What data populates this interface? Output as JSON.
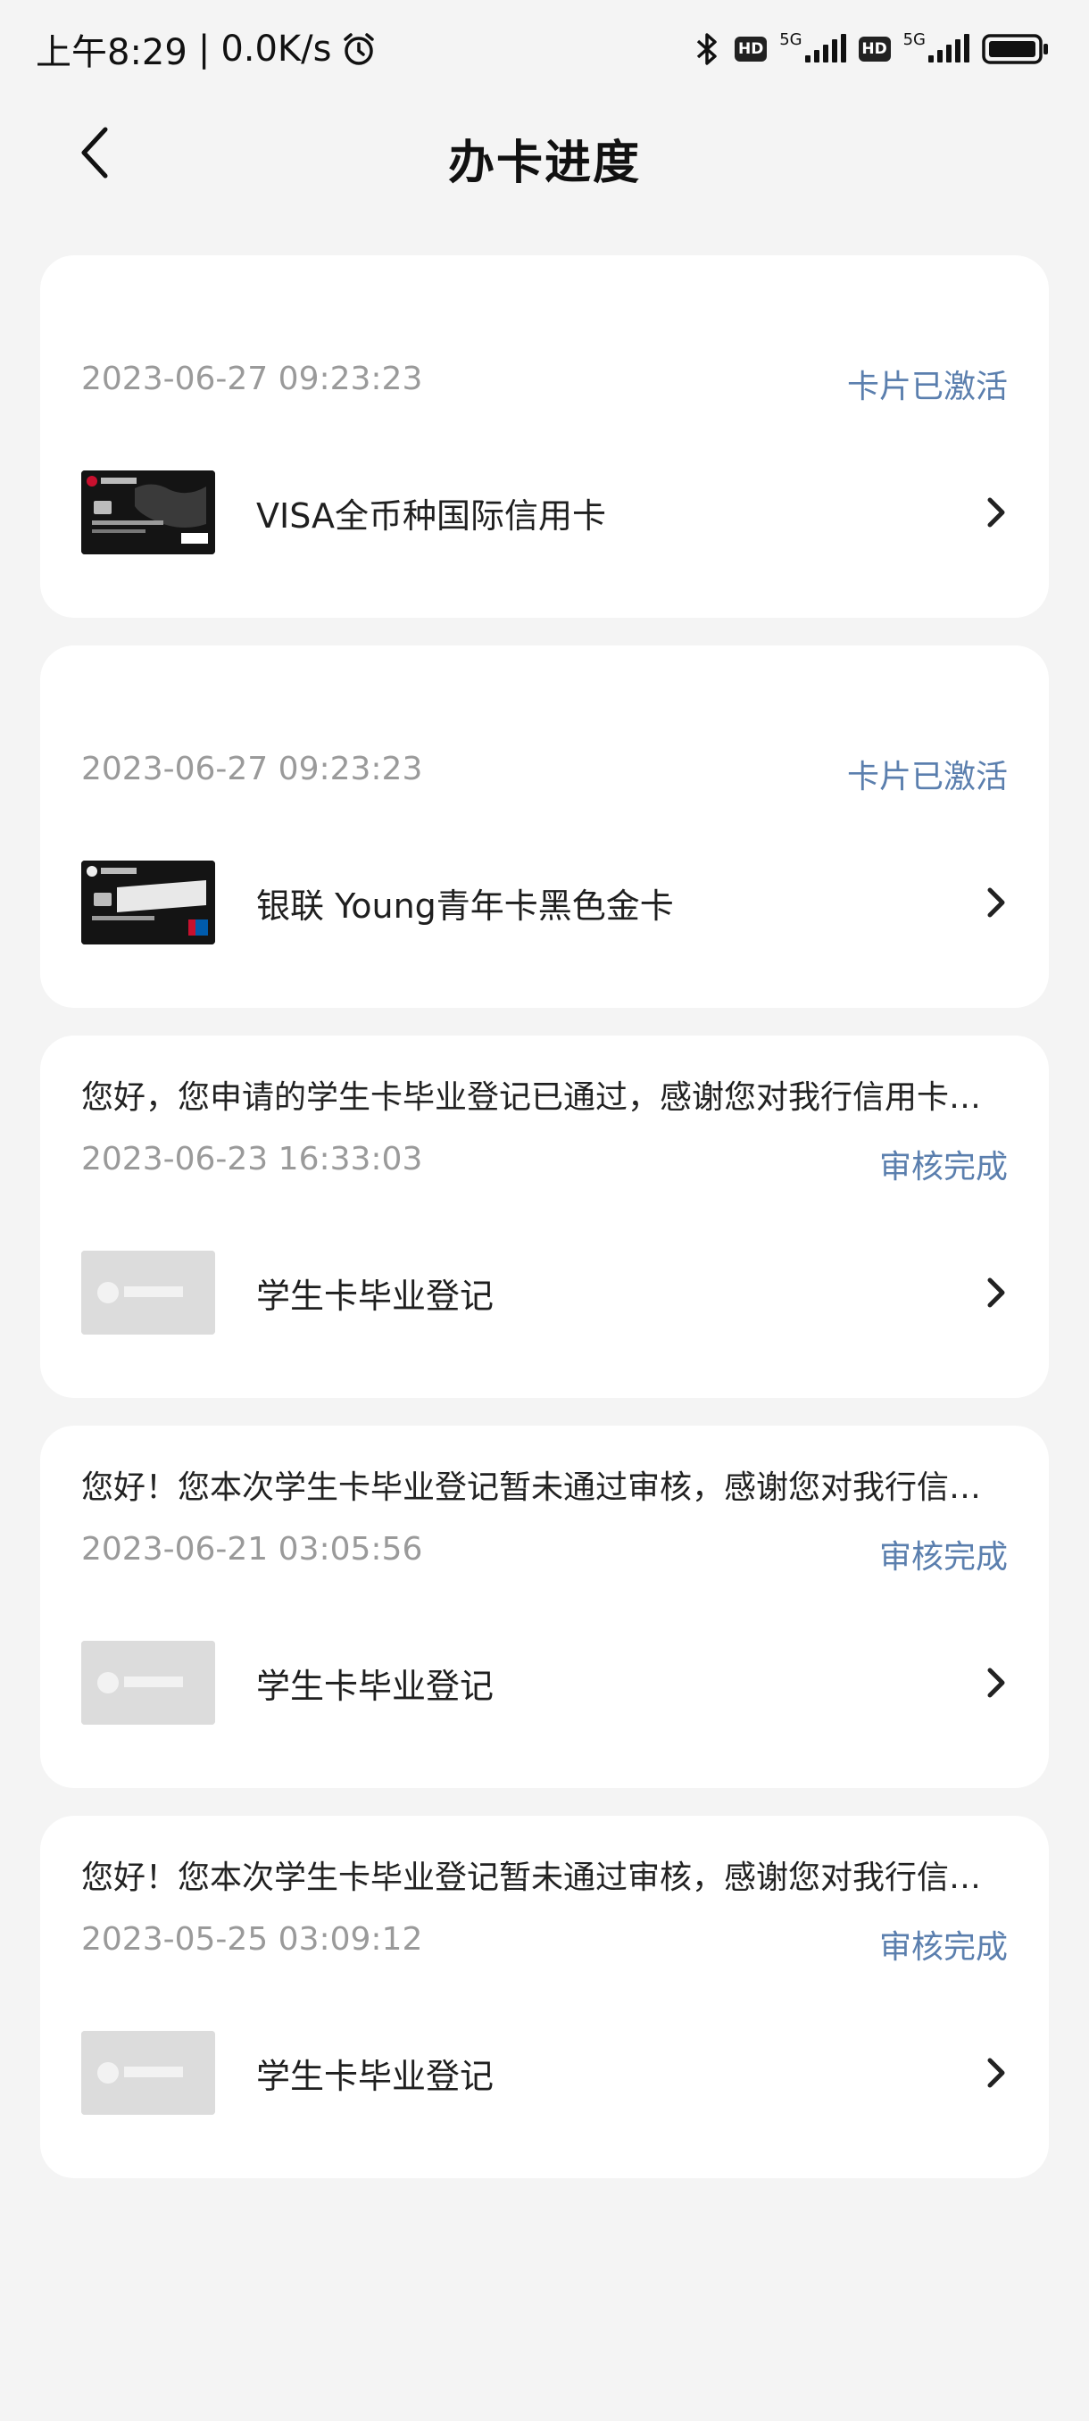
{
  "status_bar": {
    "time": "上午8:29",
    "separator": "|",
    "speed": "0.0K/s",
    "hd1": "HD",
    "net1": "5G",
    "hd2": "HD",
    "net2": "5G",
    "icons": [
      "alarm-icon",
      "bluetooth-icon",
      "signal-icon",
      "battery-icon"
    ]
  },
  "header": {
    "title": "办卡进度"
  },
  "cards": [
    {
      "message": "",
      "date": "2023-06-27 09:23:23",
      "status": "卡片已激活",
      "name": "VISA全币种国际信用卡",
      "thumb_style": "dark"
    },
    {
      "message": "",
      "date": "2023-06-27 09:23:23",
      "status": "卡片已激活",
      "name": "银联 Young青年卡黑色金卡",
      "thumb_style": "dark"
    },
    {
      "message": "您好，您申请的学生卡毕业登记已通过，感谢您对我行信用卡…",
      "date": "2023-06-23 16:33:03",
      "status": "审核完成",
      "name": "学生卡毕业登记",
      "thumb_style": "light"
    },
    {
      "message": "您好！您本次学生卡毕业登记暂未通过审核，感谢您对我行信…",
      "date": "2023-06-21 03:05:56",
      "status": "审核完成",
      "name": "学生卡毕业登记",
      "thumb_style": "light"
    },
    {
      "message": "您好！您本次学生卡毕业登记暂未通过审核，感谢您对我行信…",
      "date": "2023-05-25 03:09:12",
      "status": "审核完成",
      "name": "学生卡毕业登记",
      "thumb_style": "light"
    }
  ],
  "colors": {
    "background": "#f4f4f4",
    "card": "#ffffff",
    "status_text": "#5b7fae",
    "date_text": "#9a9a9a"
  }
}
